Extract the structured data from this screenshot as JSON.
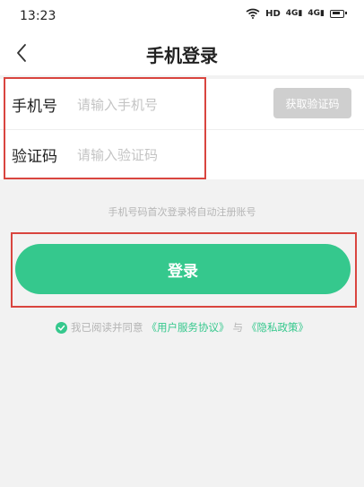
{
  "status_bar": {
    "time": "13:23",
    "hd_label": "HD",
    "signal_1": "4G",
    "signal_2": "4G"
  },
  "header": {
    "title": "手机登录"
  },
  "form": {
    "phone_label": "手机号",
    "phone_placeholder": "请输入手机号",
    "phone_value": "",
    "code_label": "验证码",
    "code_placeholder": "请输入验证码",
    "code_value": "",
    "get_code_label": "获取验证码"
  },
  "hint": "手机号码首次登录将自动注册账号",
  "login_label": "登录",
  "agreement": {
    "prefix": "我已阅读并同意",
    "user_agreement": "《用户服务协议》",
    "conjunction": "与",
    "privacy_policy": "《隐私政策》",
    "checked": true
  },
  "colors": {
    "accent": "#35c88d",
    "highlight": "#d9453f",
    "disabled_button": "#cfcfcf"
  }
}
